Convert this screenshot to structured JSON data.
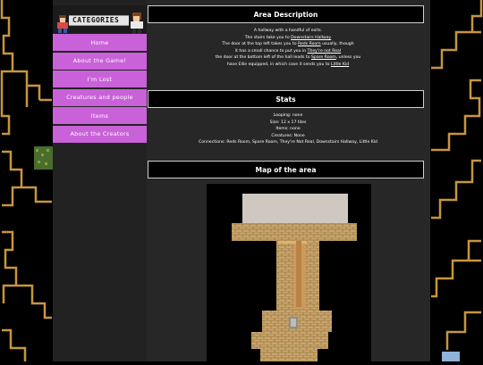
{
  "sidebar": {
    "header": "CATEGORIES",
    "items": [
      {
        "label": "Home"
      },
      {
        "label": "About the Game!"
      },
      {
        "label": "I'm Lost"
      },
      {
        "label": "Creatures and people"
      },
      {
        "label": "Items"
      },
      {
        "label": "About the Creators"
      }
    ]
  },
  "area": {
    "title": "Area Description",
    "lines": [
      {
        "a": "A hallway with a handful of exits.",
        "link": "",
        "b": ""
      },
      {
        "a": "The stairs take you to ",
        "link": "Downstairs Hallway",
        "b": ""
      },
      {
        "a": "The door at the top left takes you to ",
        "link": "Reds Room",
        "b": " usually, though"
      },
      {
        "a": "it has a small chance to put you in ",
        "link": "They're not Real",
        "b": ""
      },
      {
        "a": "the door at the bottom left of the hall leads to ",
        "link": "Spare Room",
        "b": ", unless you"
      },
      {
        "a": "have Ellie equipped, in which case it sends you to ",
        "link": "Little Kid",
        "b": ""
      }
    ]
  },
  "stats": {
    "title": "Stats",
    "lines": [
      "Looping: none",
      "Size: 12 x 17 tiles",
      "Items: none",
      "Creatures: None",
      "Connections: Reds Room, Spare Room, They're Not Real, Downstairs Hallway, Little Kid"
    ]
  },
  "map": {
    "title": "Map of the area"
  },
  "colors": {
    "nav_bg": "#c962d8",
    "panel_bg": "#272727",
    "wall": "#c8a46a",
    "floor": "#cfc8c0"
  }
}
